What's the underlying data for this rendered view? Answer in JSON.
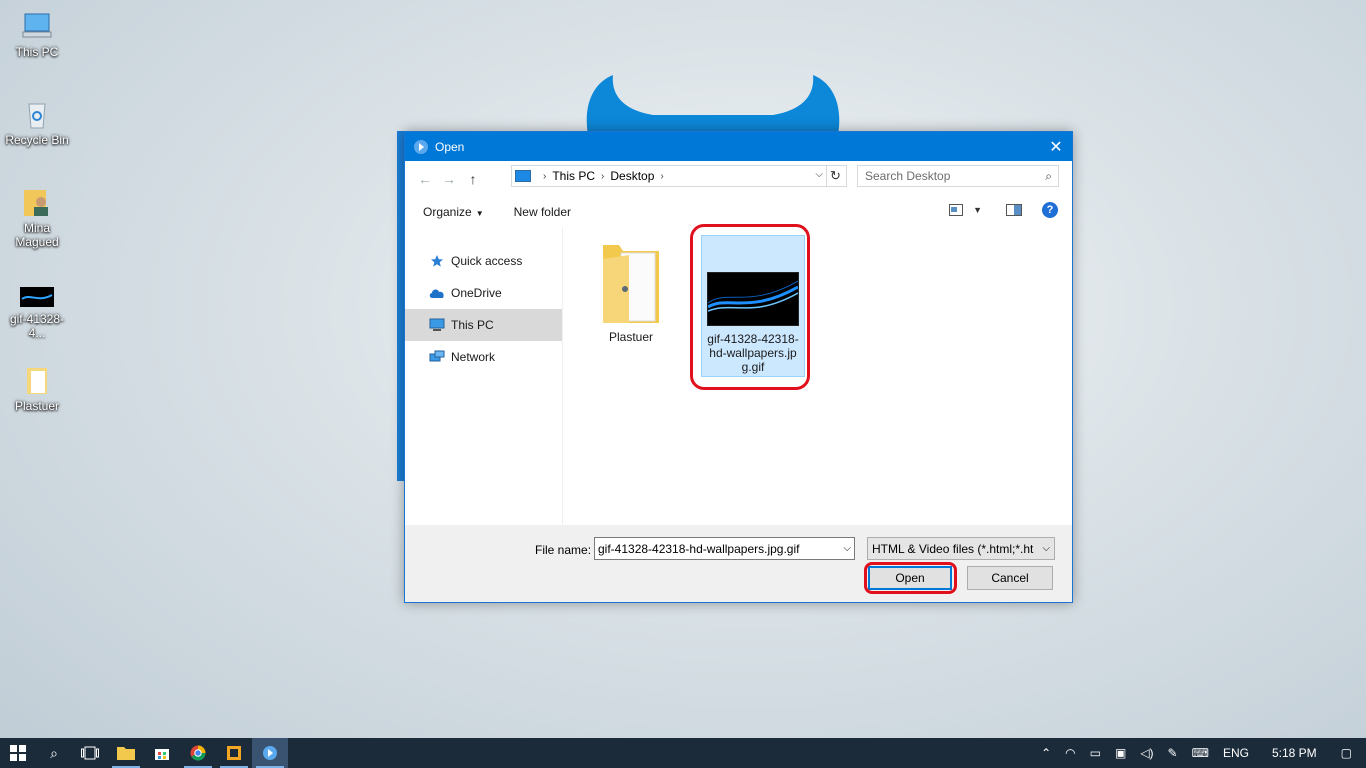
{
  "desktop": {
    "icons": [
      {
        "label": "This PC"
      },
      {
        "label": "Recycle Bin"
      },
      {
        "label": "Mina Magued"
      },
      {
        "label": "gif-41328-4..."
      },
      {
        "label": "Plastuer"
      }
    ]
  },
  "dialog": {
    "title": "Open",
    "close_glyph": "✕",
    "nav": {
      "back": "←",
      "forward": "→",
      "up": "↑",
      "breadcrumb": [
        "This PC",
        "Desktop"
      ],
      "search_placeholder": "Search Desktop"
    },
    "toolbar": {
      "organize": "Organize",
      "new_folder": "New folder",
      "help": "?"
    },
    "sidebar": [
      {
        "label": "Quick access",
        "icon": "star-icon"
      },
      {
        "label": "OneDrive",
        "icon": "cloud-icon"
      },
      {
        "label": "This PC",
        "icon": "computer-icon",
        "selected": true
      },
      {
        "label": "Network",
        "icon": "network-icon"
      }
    ],
    "files": [
      {
        "name": "Plastuer",
        "type": "folder"
      },
      {
        "name": "gif-41328-42318-hd-wallpapers.jpg.gif",
        "name_lines": [
          "gif-41328-42318-",
          "hd-wallpapers.jp",
          "g.gif"
        ],
        "type": "image",
        "selected": true
      }
    ],
    "footer": {
      "file_name_label": "File name:",
      "file_name_value": "gif-41328-42318-hd-wallpapers.jpg.gif",
      "filter": "HTML & Video files (*.html;*.ht",
      "open": "Open",
      "cancel": "Cancel"
    }
  },
  "taskbar": {
    "language": "ENG",
    "time": "5:18 PM"
  },
  "colors": {
    "titlebar": "#0078d7",
    "highlight": "#e0101c",
    "selection": "#cce8ff",
    "taskbar": "#1c2b3a"
  }
}
